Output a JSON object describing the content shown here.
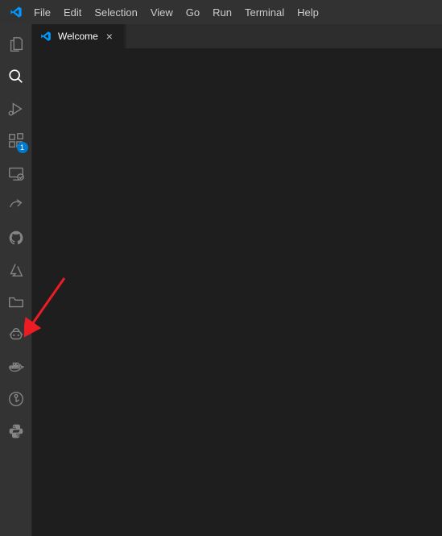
{
  "menu": {
    "file": "File",
    "edit": "Edit",
    "selection": "Selection",
    "view": "View",
    "go": "Go",
    "run": "Run",
    "terminal": "Terminal",
    "help": "Help"
  },
  "tab": {
    "welcome_label": "Welcome"
  },
  "activitybar": {
    "extensions_badge": "1"
  },
  "colors": {
    "accent": "#007acc",
    "activity_icon": "#858585",
    "arrow": "#ed1c24"
  }
}
